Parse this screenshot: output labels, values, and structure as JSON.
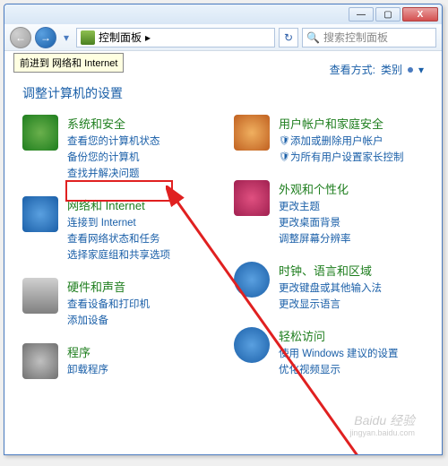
{
  "titlebar": {
    "minimize": "—",
    "maximize": "▢",
    "close": "X"
  },
  "nav": {
    "back": "←",
    "forward": "→",
    "dropdown": "▾",
    "crumb": "控制面板",
    "crumb_arrow": "▸",
    "refresh": "↻",
    "search_placeholder": "搜索控制面板",
    "search_icon": "🔍",
    "tooltip": "前进到 网络和 Internet"
  },
  "view": {
    "label": "查看方式:",
    "value": "类别",
    "arrow": "▾"
  },
  "page_title": "调整计算机的设置",
  "left": [
    {
      "title": "系统和安全",
      "icon": "ic-sec",
      "links": [
        {
          "text": "查看您的计算机状态"
        },
        {
          "text": "备份您的计算机"
        },
        {
          "text": "查找并解决问题"
        }
      ]
    },
    {
      "title": "网络和 Internet",
      "icon": "ic-net",
      "links": [
        {
          "text": "连接到 Internet"
        },
        {
          "text": "查看网络状态和任务"
        },
        {
          "text": "选择家庭组和共享选项"
        }
      ]
    },
    {
      "title": "硬件和声音",
      "icon": "ic-hw",
      "links": [
        {
          "text": "查看设备和打印机"
        },
        {
          "text": "添加设备"
        }
      ]
    },
    {
      "title": "程序",
      "icon": "ic-prog",
      "links": [
        {
          "text": "卸载程序"
        }
      ]
    }
  ],
  "right": [
    {
      "title": "用户帐户和家庭安全",
      "icon": "ic-user",
      "links": [
        {
          "text": "添加或删除用户帐户",
          "shield": true
        },
        {
          "text": "为所有用户设置家长控制",
          "shield": true
        }
      ]
    },
    {
      "title": "外观和个性化",
      "icon": "ic-appear",
      "links": [
        {
          "text": "更改主题"
        },
        {
          "text": "更改桌面背景"
        },
        {
          "text": "调整屏幕分辨率"
        }
      ]
    },
    {
      "title": "时钟、语言和区域",
      "icon": "ic-clock",
      "links": [
        {
          "text": "更改键盘或其他输入法"
        },
        {
          "text": "更改显示语言"
        }
      ]
    },
    {
      "title": "轻松访问",
      "icon": "ic-ease",
      "links": [
        {
          "text": "使用 Windows 建议的设置"
        },
        {
          "text": "优化视频显示"
        }
      ]
    }
  ],
  "watermark": {
    "brand": "Baidu 经验",
    "url": "jingyan.baidu.com"
  }
}
